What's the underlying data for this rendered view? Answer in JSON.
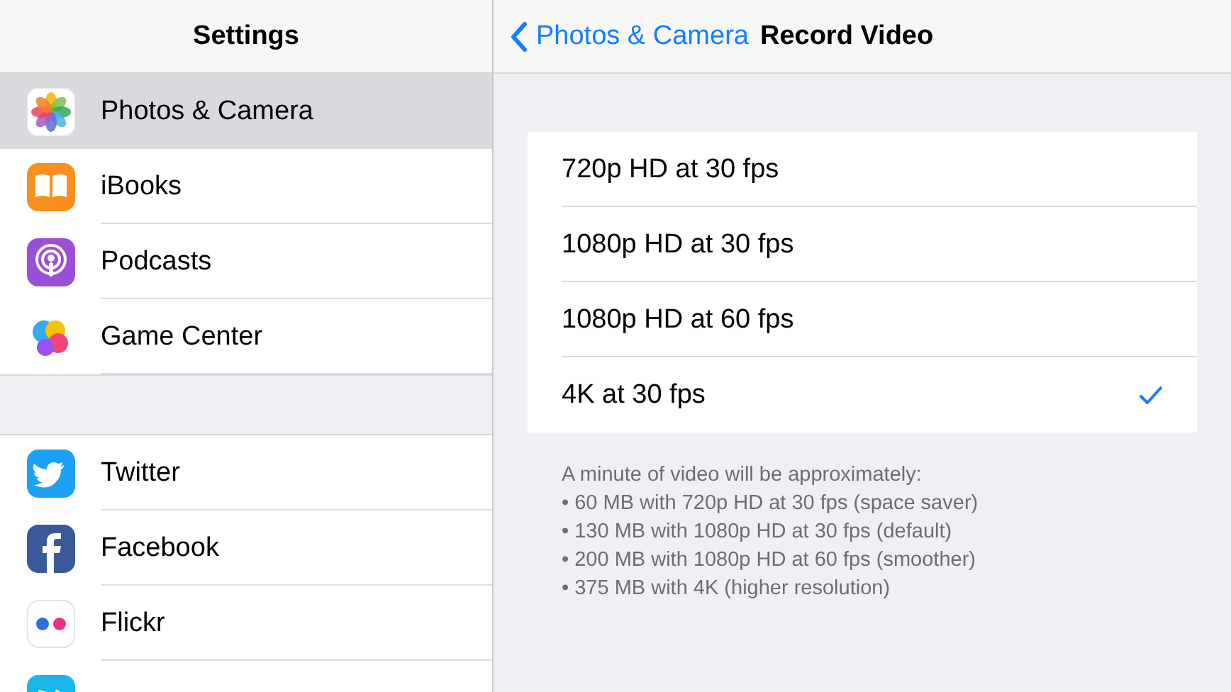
{
  "sidebar": {
    "title": "Settings",
    "groups": [
      {
        "items": [
          {
            "label": "Photos & Camera",
            "kind": "photos",
            "selected": true
          },
          {
            "label": "iBooks",
            "kind": "books",
            "selected": false
          },
          {
            "label": "Podcasts",
            "kind": "podcasts",
            "selected": false
          },
          {
            "label": "Game Center",
            "kind": "gamecenter",
            "selected": false
          }
        ]
      },
      {
        "items": [
          {
            "label": "Twitter",
            "kind": "twitter",
            "selected": false
          },
          {
            "label": "Facebook",
            "kind": "facebook",
            "selected": false
          },
          {
            "label": "Flickr",
            "kind": "flickr",
            "selected": false
          },
          {
            "kind": "vimeo",
            "selected": false
          }
        ]
      }
    ]
  },
  "detail": {
    "back": "Photos & Camera",
    "title": "Record Video",
    "options": [
      {
        "label": "720p HD at 30 fps",
        "selected": false
      },
      {
        "label": "1080p HD at 30 fps",
        "selected": false
      },
      {
        "label": "1080p HD at 60 fps",
        "selected": false
      },
      {
        "label": "4K at 30 fps",
        "selected": true
      }
    ],
    "footer": [
      "A minute of video will be approximately:",
      "• 60 MB with 720p HD at 30 fps (space saver)",
      "• 130 MB with 1080p HD at 30 fps (default)",
      "• 200 MB with 1080p HD at 60 fps (smoother)",
      "• 375 MB with 4K (higher resolution)"
    ]
  }
}
